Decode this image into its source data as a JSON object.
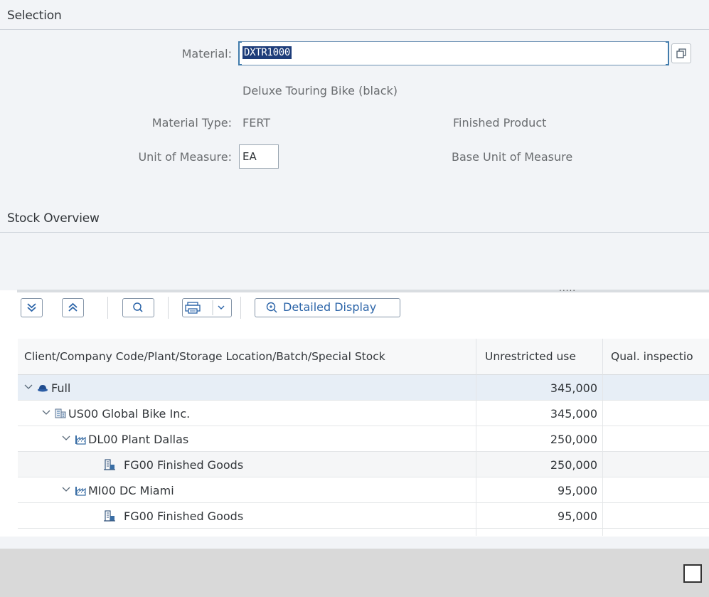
{
  "selection": {
    "title": "Selection",
    "material_label": "Material:",
    "material_value": "DXTR1000",
    "material_description": "Deluxe Touring Bike (black)",
    "material_type_label": "Material Type:",
    "material_type_value": "FERT",
    "material_type_desc": "Finished Product",
    "uom_label": "Unit of Measure:",
    "uom_value": "EA",
    "uom_desc": "Base Unit of Measure"
  },
  "stock_overview": {
    "title": "Stock Overview",
    "splitter_dots": ".....",
    "toolbar": {
      "expand_all_icon": "expand-all-icon",
      "collapse_all_icon": "collapse-all-icon",
      "find_icon": "search-icon",
      "print_icon": "print-icon",
      "detailed_display_label": "Detailed Display"
    },
    "columns": [
      "Client/Company Code/Plant/Storage Location/Batch/Special Stock",
      "Unrestricted use",
      "Qual. inspectio"
    ],
    "rows": [
      {
        "name": "Full",
        "unrestricted": "345,000",
        "icon": "client-icon"
      },
      {
        "name": "US00 Global Bike Inc.",
        "unrestricted": "345,000",
        "icon": "company-icon"
      },
      {
        "name": "DL00 Plant Dallas",
        "unrestricted": "250,000",
        "icon": "plant-icon"
      },
      {
        "name": "FG00 Finished Goods",
        "unrestricted": "250,000",
        "icon": "storage-location-icon"
      },
      {
        "name": "MI00 DC Miami",
        "unrestricted": "95,000",
        "icon": "plant-icon"
      },
      {
        "name": "FG00 Finished Goods",
        "unrestricted": "95,000",
        "icon": "storage-location-icon"
      }
    ]
  }
}
